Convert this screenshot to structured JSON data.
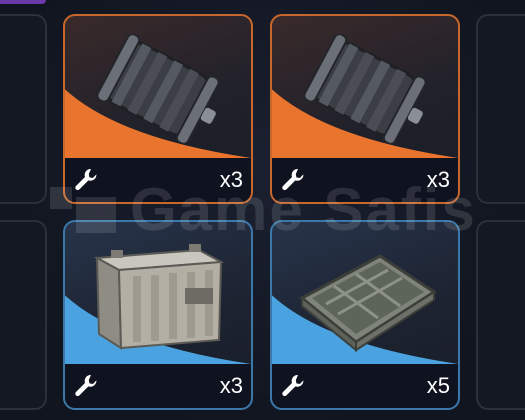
{
  "inventory": {
    "slots": [
      {
        "state": "empty"
      },
      {
        "item": "stator-drum",
        "rarity": "orange",
        "quantity": "x3",
        "icon": "wrench-icon"
      },
      {
        "item": "stator-drum",
        "rarity": "orange",
        "quantity": "x3",
        "icon": "wrench-icon"
      },
      {
        "state": "empty"
      },
      {
        "state": "empty"
      },
      {
        "item": "car-battery",
        "rarity": "blue",
        "quantity": "x3",
        "icon": "wrench-icon"
      },
      {
        "item": "metal-tray",
        "rarity": "blue",
        "quantity": "x5",
        "icon": "wrench-icon"
      },
      {
        "state": "empty"
      }
    ]
  },
  "watermark": {
    "text": "Game Safis"
  },
  "colors": {
    "orange_rarity": "#e8742e",
    "blue_rarity": "#4aa3e0",
    "background": "#121621"
  }
}
